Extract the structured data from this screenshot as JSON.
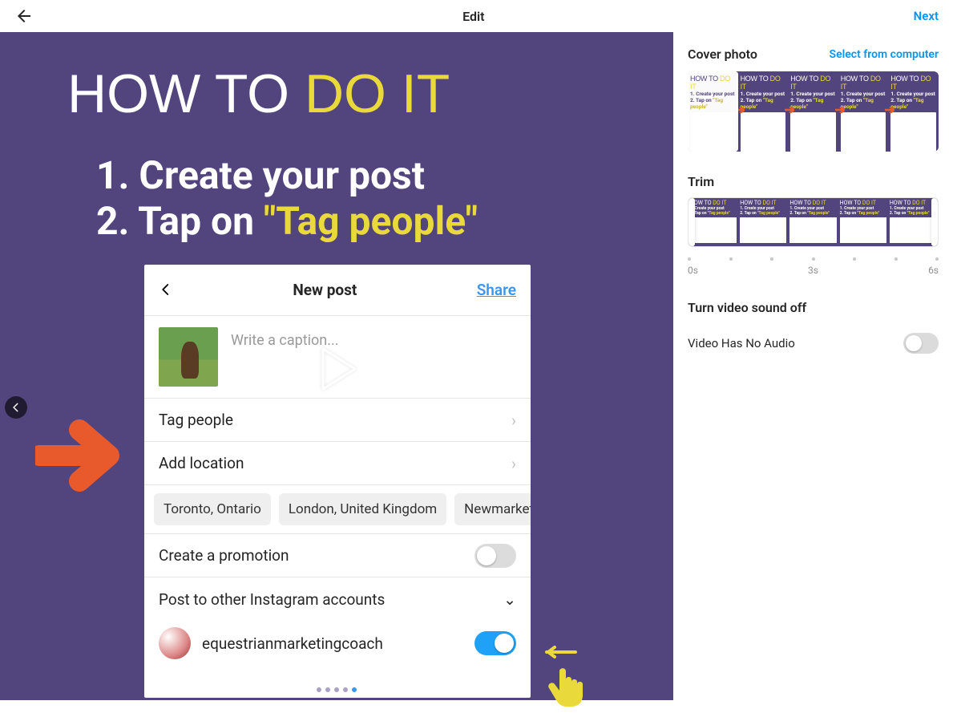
{
  "topbar": {
    "title": "Edit",
    "next": "Next"
  },
  "preview": {
    "headline_white": "HOW TO",
    "headline_yellow": "DO IT",
    "step1_num": "1.",
    "step1_text": "Create your post",
    "step2_num": "2.",
    "step2_text_white": "Tap on",
    "step2_text_yellow": "\"Tag people\"",
    "dots": {
      "count": 5,
      "active_index": 4
    }
  },
  "phonecard": {
    "header_title": "New post",
    "header_share": "Share",
    "caption_placeholder": "Write a caption...",
    "tag_people": "Tag people",
    "add_location": "Add location",
    "location_chips": [
      "Toronto, Ontario",
      "London, United Kingdom",
      "Newmarket,"
    ],
    "create_promo": "Create a promotion",
    "post_other": "Post to other Instagram accounts",
    "account_handle": "equestrianmarketingcoach"
  },
  "sidebar": {
    "cover_label": "Cover photo",
    "select_link": "Select from computer",
    "trim_label": "Trim",
    "ticks": {
      "start": "0s",
      "mid": "3s",
      "end": "6s"
    },
    "audio_title": "Turn video sound off",
    "audio_status": "Video Has No Audio",
    "thumb_title_a": "HOW TO",
    "thumb_title_b": "DO IT",
    "thumb_l1": "1. Create your post",
    "thumb_l2a": "2. Tap on ",
    "thumb_l2b": "\"Tag people\""
  }
}
